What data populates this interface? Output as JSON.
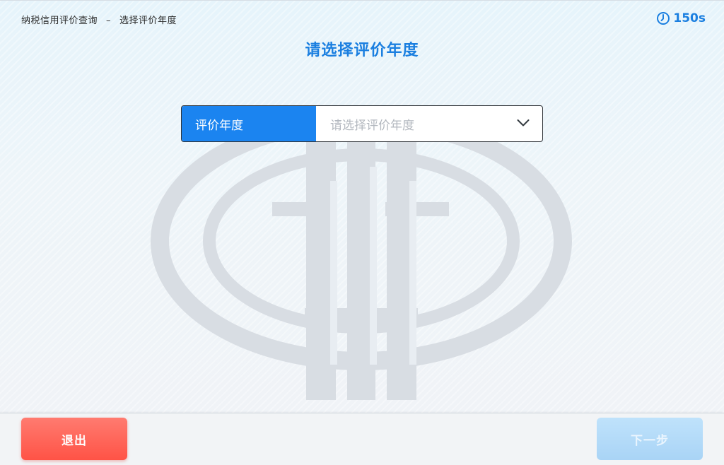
{
  "header": {
    "breadcrumb_root": "纳税信用评价查询",
    "breadcrumb_separator": "–",
    "breadcrumb_current": "选择评价年度",
    "timer_icon": "clock-icon",
    "timer_value": "150s"
  },
  "main": {
    "title": "请选择评价年度",
    "watermark_icon": "tax-emblem-watermark",
    "year_select": {
      "label": "评价年度",
      "placeholder": "请选择评价年度",
      "icon": "chevron-down-icon"
    }
  },
  "footer": {
    "exit_label": "退出",
    "next_label": "下一步"
  },
  "colors": {
    "accent": "#1b84f0",
    "title": "#1b7fe0",
    "exit_button": "#ff5a4e",
    "next_button_disabled": "#b3dbf8"
  }
}
